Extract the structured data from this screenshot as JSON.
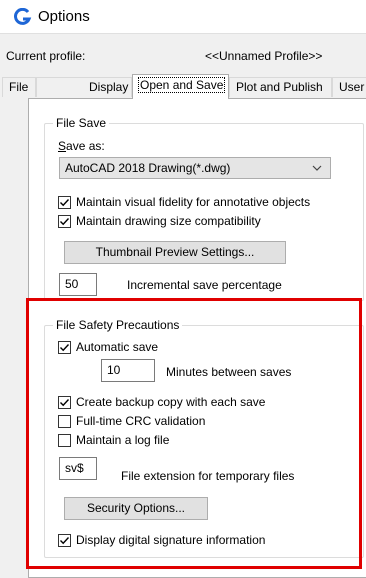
{
  "window": {
    "title": "Options",
    "app_icon": "autocad-g-logo-icon",
    "accent": "#1e66d6"
  },
  "profile": {
    "label": "Current profile:",
    "name": "<<Unnamed Profile>>"
  },
  "tabs": [
    {
      "label": "File"
    },
    {
      "label": "Display"
    },
    {
      "label": "Open and Save",
      "active": true
    },
    {
      "label": "Plot and Publish"
    },
    {
      "label": "User P"
    }
  ],
  "file_save": {
    "title": "File Save",
    "save_as_label": "Save as:",
    "save_as_value": "AutoCAD 2018 Drawing(*.dwg)",
    "maintain_fidelity": {
      "label": "Maintain visual fidelity for annotative objects",
      "checked": true
    },
    "maintain_size": {
      "label": "Maintain drawing size compatibility",
      "checked": true
    },
    "thumbnail_button": "Thumbnail Preview Settings...",
    "incremental_value": "50",
    "incremental_label": "Incremental save percentage"
  },
  "file_safety": {
    "title": "File Safety Precautions",
    "automatic_save": {
      "label": "Automatic save",
      "checked": true
    },
    "minutes_value": "10",
    "minutes_label": "Minutes between saves",
    "backup_copy": {
      "label": "Create backup copy with each save",
      "checked": true
    },
    "crc_validation": {
      "label": "Full-time CRC validation",
      "checked": false
    },
    "log_file": {
      "label": "Maintain a log file",
      "checked": false
    },
    "temp_ext_value": "sv$",
    "temp_ext_label": "File extension for temporary files",
    "security_button": "Security Options...",
    "digital_signature": {
      "label": "Display digital signature information",
      "checked": true
    }
  },
  "highlight_color": "#e00000"
}
